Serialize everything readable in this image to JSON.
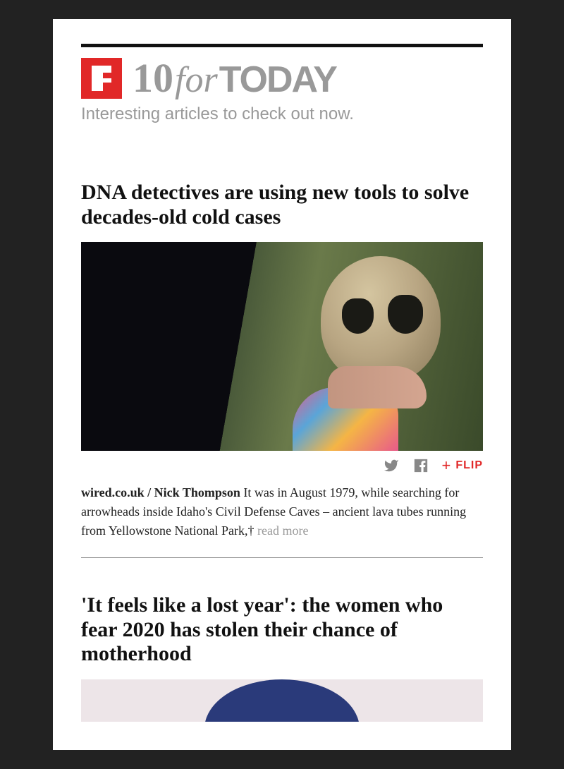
{
  "header": {
    "brand_number": "10",
    "brand_for": "for",
    "brand_today": "TODAY",
    "tagline": "Interesting articles to check out now."
  },
  "social": {
    "flip_label": "FLIP"
  },
  "articles": [
    {
      "title": "DNA detectives are using new tools to solve decades-old cold cases",
      "byline": "wired.co.uk / Nick Thompson",
      "excerpt": " It was in August 1979, while searching for arrowheads inside Idaho's Civil Defense Caves – ancient lava tubes running from Yellowstone National Park,† ",
      "read_more": "read more"
    },
    {
      "title": "'It feels like a lost year': the women who fear 2020 has stolen their chance of motherhood"
    }
  ]
}
